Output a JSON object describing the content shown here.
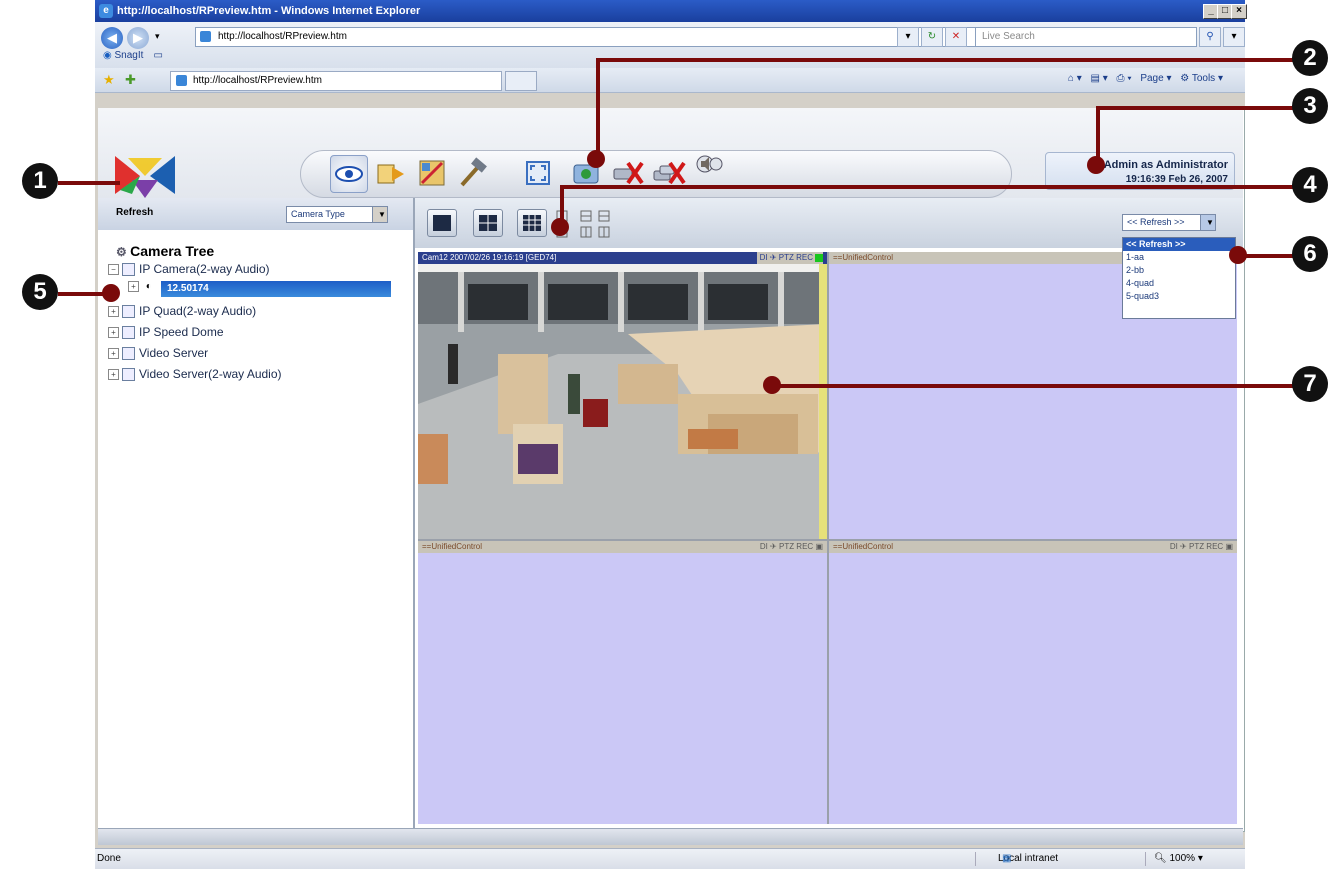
{
  "browser": {
    "title": "http://localhost/RPreview.htm - Windows Internet Explorer",
    "address": "http://localhost/RPreview.htm",
    "search_placeholder": "Live Search",
    "links_bar": "SnagIt",
    "tab_title": "http://localhost/RPreview.htm",
    "page_menu": "Page",
    "tools_menu": "Tools",
    "status_text": "Done",
    "zone": "Local intranet",
    "zoom": "100%"
  },
  "header": {
    "login_line1": "Admin as Administrator",
    "login_line2": "19:16:39 Feb 26, 2007"
  },
  "left_panel": {
    "refresh_label": "Refresh",
    "camera_type_select": "Camera Type",
    "tree_title": "Camera Tree",
    "tree_items": [
      {
        "label": "IP Camera(2-way Audio)",
        "expander": "−"
      },
      {
        "label": "IP Quad(2-way Audio)",
        "expander": "+"
      },
      {
        "label": "IP Speed Dome",
        "expander": "+"
      },
      {
        "label": "Video Server",
        "expander": "+"
      },
      {
        "label": "Video Server(2-way Audio)",
        "expander": "+"
      }
    ],
    "selected_node": "12.50174"
  },
  "video_toolbar": {
    "refresh_select": "<< Refresh >>",
    "dropdown_options": [
      "<< Refresh >>",
      "1-aa",
      "2-bb",
      "4-quad",
      "5-quad3"
    ]
  },
  "video_panes": [
    {
      "name": "Cam12 2007/02/26 19:16:19 [GED74]",
      "controls": "DI ✈ PTZ REC"
    },
    {
      "name": "==UnifiedControl",
      "controls": ""
    },
    {
      "name": "==UnifiedControl",
      "controls": "DI ✈ PTZ REC"
    },
    {
      "name": "==UnifiedControl",
      "controls": "DI ✈ PTZ REC"
    }
  ],
  "callouts": [
    "1",
    "2",
    "3",
    "4",
    "5",
    "6",
    "7"
  ],
  "colors": {
    "callout_line": "#7a0a0a",
    "video_bg": "#cbc8f6",
    "selection": "#2a5dbc"
  }
}
